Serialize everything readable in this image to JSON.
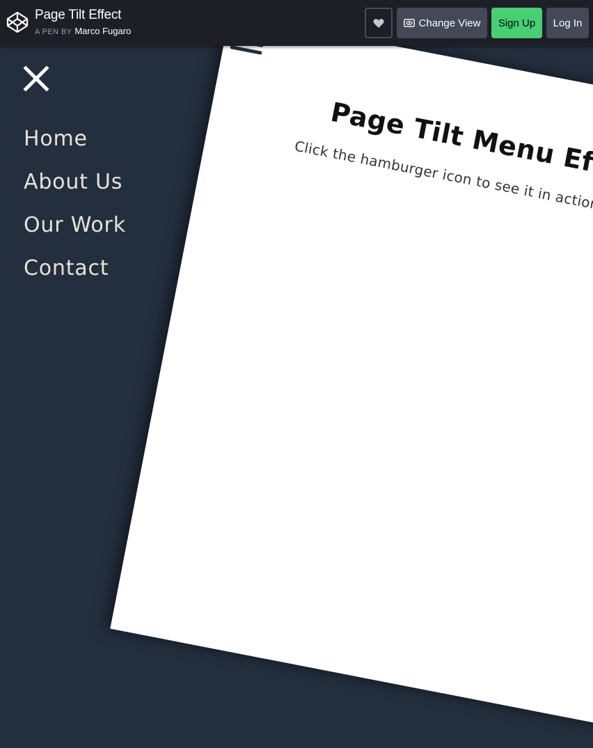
{
  "header": {
    "title": "Page Tilt Effect",
    "byline_prefix": "A PEN BY",
    "author": "Marco Fugaro",
    "logo_icon": "codepen-logo-icon",
    "heart_icon": "heart-icon",
    "change_view_label": "Change View",
    "change_view_icon": "eye-icon",
    "signup_label": "Sign Up",
    "login_label": "Log In",
    "colors": {
      "bar": "#1e1f26",
      "button": "#444857",
      "signup": "#47cf73"
    }
  },
  "menu": {
    "close_icon": "close-icon",
    "items": [
      {
        "label": "Home"
      },
      {
        "label": "About Us"
      },
      {
        "label": "Our Work"
      },
      {
        "label": "Contact"
      }
    ],
    "colors": {
      "background": "#232f3f",
      "text": "#e9e2d3"
    }
  },
  "page": {
    "hamburger_icon": "hamburger-icon",
    "heading": "Page Tilt Menu Effect",
    "subtitle": "Click the hamburger icon to see it in action"
  }
}
